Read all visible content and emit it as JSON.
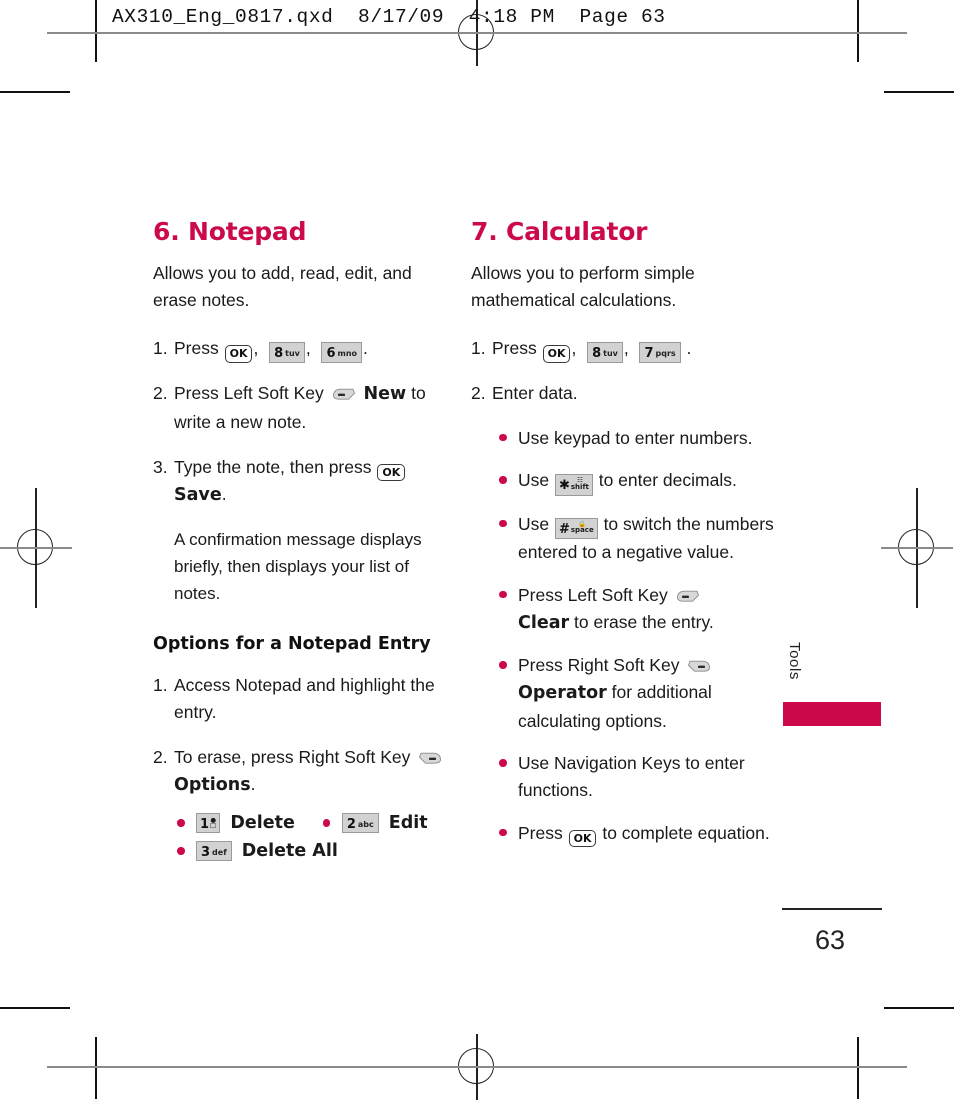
{
  "slug": "AX310_Eng_0817.qxd  8/17/09  4:18 PM  Page 63",
  "brand_color": "#cc0a4b",
  "left_column": {
    "heading": "6. Notepad",
    "lead": "Allows you to add, read, edit, and erase notes.",
    "steps": [
      {
        "num": "1.",
        "pre": "Press ",
        "keys": [
          "OK",
          "8 tuv",
          "6 mno"
        ],
        "post": "."
      },
      {
        "num": "2.",
        "pre": "Press Left Soft Key ",
        "softkey": "left-soft-key",
        "bold": "New",
        "post": " to write a new note."
      },
      {
        "num": "3.",
        "pre": "Type the note, then press ",
        "key": "OK",
        "bold": "Save",
        "post": "."
      }
    ],
    "note": "A confirmation message displays briefly, then displays your list of notes.",
    "subheading": "Options for a Notepad Entry",
    "steps2": [
      {
        "num": "1.",
        "text": "Access Notepad and highlight the entry."
      },
      {
        "num": "2.",
        "pre": "To erase, press Right Soft Key ",
        "softkey": "right-soft-key",
        "bold": "Options",
        "post": "."
      }
    ],
    "option_items": [
      {
        "key_big": "1",
        "key_small": "✉",
        "label": "Delete"
      },
      {
        "key_big": "2",
        "key_small": "abc",
        "label": "Edit"
      },
      {
        "key_big": "3",
        "key_small": "def",
        "label": "Delete All"
      }
    ]
  },
  "right_column": {
    "heading": "7. Calculator",
    "lead": "Allows you to perform simple mathematical calculations.",
    "steps": [
      {
        "num": "1.",
        "pre": "Press ",
        "keys": [
          "OK",
          "8 tuv",
          "7 pqrs"
        ],
        "post": "."
      },
      {
        "num": "2.",
        "text": "Enter data."
      }
    ],
    "bullets": [
      {
        "text": "Use keypad to enter numbers."
      },
      {
        "pre": "Use ",
        "key": "* shift",
        "post": " to enter decimals."
      },
      {
        "pre": "Use ",
        "key": "# space",
        "post": " to switch the numbers entered to a negative value."
      },
      {
        "pre": "Press Left Soft Key ",
        "softkey": "left-soft-key",
        "bold": "Clear",
        "post": " to erase the entry."
      },
      {
        "pre": "Press Right Soft Key ",
        "softkey": "right-soft-key",
        "bold": "Operator",
        "post": " for additional calculating options."
      },
      {
        "text": "Use Navigation Keys to enter functions."
      },
      {
        "pre": "Press ",
        "key": "OK",
        "post": " to complete equation."
      }
    ]
  },
  "side_tab": {
    "label": "Tools"
  },
  "footer": {
    "page_number": "63"
  }
}
